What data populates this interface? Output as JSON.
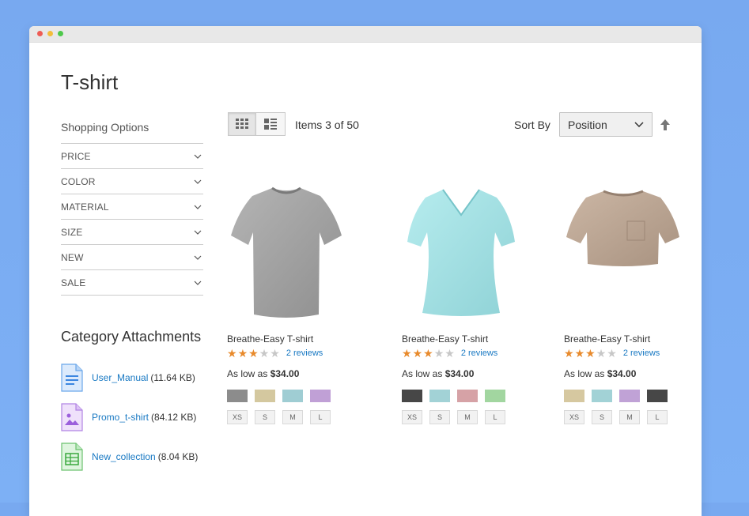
{
  "page": {
    "title": "T-shirt"
  },
  "sidebar": {
    "shopping_title": "Shopping Options",
    "filters": [
      "PRICE",
      "COLOR",
      "MATERIAL",
      "SIZE",
      "NEW",
      "SALE"
    ],
    "attachments_title": "Category Attachments",
    "attachments": [
      {
        "name": "User_Manual",
        "size": "(11.64 KB)",
        "icon": "document-icon"
      },
      {
        "name": "Promo_t-shirt",
        "size": " (84.12 KB)",
        "icon": "image-file-icon"
      },
      {
        "name": "New_collection",
        "size": "(8.04 KB)",
        "icon": "spreadsheet-icon"
      }
    ]
  },
  "toolbar": {
    "items_text": "Items 3 of 50",
    "sort_label": "Sort By",
    "sort_value": "Position"
  },
  "products": [
    {
      "name": "Breathe-Easy T-shirt",
      "rating": 3,
      "reviews": "2 reviews",
      "price_prefix": "As low as",
      "price": "$34.00",
      "color": "#a9a9a9",
      "swatches": [
        "#8c8c8c",
        "#d4c89f",
        "#9fcdd3",
        "#c0a0d6"
      ],
      "sizes": [
        "XS",
        "S",
        "M",
        "L"
      ]
    },
    {
      "name": "Breathe-Easy T-shirt",
      "rating": 3,
      "reviews": "2 reviews",
      "price_prefix": "As low as",
      "price": "$34.00",
      "color": "#a6e0e2",
      "swatches": [
        "#474747",
        "#a2d2d6",
        "#d6a2a6",
        "#a2d6a0"
      ],
      "sizes": [
        "XS",
        "S",
        "M",
        "L"
      ]
    },
    {
      "name": "Breathe-Easy T-shirt",
      "rating": 3,
      "reviews": "2 reviews",
      "price_prefix": "As low as",
      "price": "$34.00",
      "color": "#bfa896",
      "swatches": [
        "#d6c8a0",
        "#a2d2d6",
        "#c0a2d6",
        "#474747"
      ],
      "sizes": [
        "XS",
        "S",
        "M",
        "L"
      ]
    }
  ],
  "colors": {
    "link": "#1979c3",
    "star_on": "#e88a2c",
    "star_off": "#c7c7c7"
  }
}
